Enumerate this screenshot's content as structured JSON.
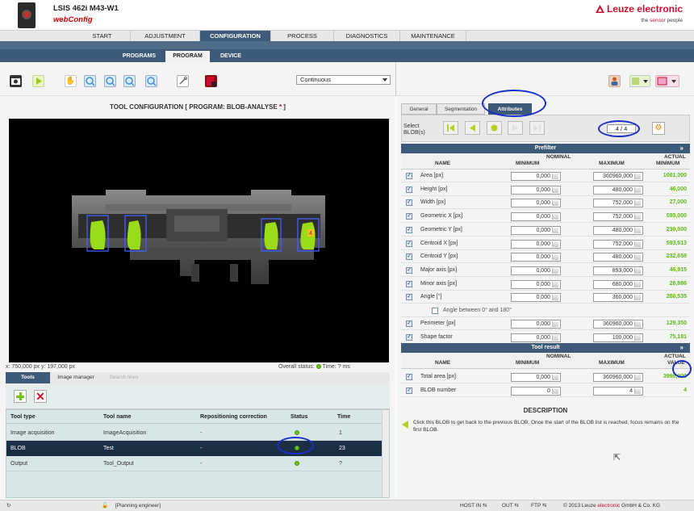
{
  "header": {
    "model": "LSIS 462i M43-W1",
    "app": "webConfig",
    "logo": "Leuze electronic",
    "tagline_pre": "the ",
    "tagline_brand": "sensor",
    "tagline_post": " people"
  },
  "main_nav": [
    "START",
    "ADJUSTMENT",
    "CONFIGURATION",
    "PROCESS",
    "DIAGNOSTICS",
    "MAINTENANCE"
  ],
  "main_nav_active": "CONFIGURATION",
  "sub_nav": [
    "PROGRAMS",
    "PROGRAM",
    "DEVICE"
  ],
  "sub_nav_active": "PROGRAM",
  "toolbar": {
    "mode_select": "Continuous",
    "icons": [
      "camera-icon",
      "play-icon",
      "hand-icon",
      "zoom-in-icon",
      "zoom-out-icon",
      "zoom-fit-icon",
      "zoom-reset-icon",
      "tools-icon",
      "save-icon",
      "user-icon",
      "layout-icon",
      "window-icon"
    ]
  },
  "tool_config": {
    "title_pre": "TOOL CONFIGURATION  [ PROGRAM: BLOB-ANALYSE ",
    "title_star": "*",
    "title_post": " ]"
  },
  "image": {
    "coords": "x: 750,000 px y: 197,000 px",
    "overall_status_label": "Overall status:",
    "time_label": "Time: ? ms",
    "blob_label": "4"
  },
  "left_tabs": [
    "Tools",
    "Image manager",
    "Search lines"
  ],
  "tools_table": {
    "headers": [
      "Tool type",
      "Tool name",
      "Repositioning correction",
      "Status",
      "Time"
    ],
    "rows": [
      {
        "type": "Image acquisition",
        "name": "ImageAcquisition",
        "repos": "-",
        "time": "1"
      },
      {
        "type": "BLOB",
        "name": "Test",
        "repos": "-",
        "time": "23"
      },
      {
        "type": "Output",
        "name": "Tool_Output",
        "repos": "-",
        "time": "?"
      }
    ]
  },
  "right_tabs": [
    "General",
    "Segmentation",
    "Attributes"
  ],
  "right_tabs_active": "Attributes",
  "blob_selector": {
    "label_line1": "Select",
    "label_line2": "BLOB(s)",
    "counter": "4 / 4"
  },
  "prefilter": {
    "title": "Prefilter",
    "col_name": "NAME",
    "col_nominal": "NOMINAL",
    "col_min": "MINIMUM",
    "col_max": "MAXIMUM",
    "col_actual1": "ACTUAL",
    "col_actual2": "MINIMUM",
    "rows": [
      {
        "name": "Area [px]",
        "min": "0,000",
        "max": "360960,000",
        "actual": "1001,000",
        "checked": true
      },
      {
        "name": "Height [px]",
        "min": "0,000",
        "max": "480,000",
        "actual": "46,000",
        "checked": true
      },
      {
        "name": "Width [px]",
        "min": "0,000",
        "max": "752,000",
        "actual": "27,000",
        "checked": true
      },
      {
        "name": "Geometric X [px]",
        "min": "0,000",
        "max": "752,000",
        "actual": "595,000",
        "checked": true
      },
      {
        "name": "Geometric Y [px]",
        "min": "0,000",
        "max": "480,000",
        "actual": "230,500",
        "checked": true
      },
      {
        "name": "Centroid X [px]",
        "min": "0,000",
        "max": "752,000",
        "actual": "593,613",
        "checked": true
      },
      {
        "name": "Centroid Y [px]",
        "min": "0,000",
        "max": "480,000",
        "actual": "232,658",
        "checked": true
      },
      {
        "name": "Major axis [px]",
        "min": "0,000",
        "max": "893,000",
        "actual": "46,915",
        "checked": true
      },
      {
        "name": "Minor axis [px]",
        "min": "0,000",
        "max": "680,000",
        "actual": "26,886",
        "checked": true
      },
      {
        "name": "Angle [°]",
        "min": "0,000",
        "max": "360,000",
        "actual": "280,535",
        "checked": true
      }
    ],
    "angle_option": "Angle between 0° and 180°",
    "rows2": [
      {
        "name": "Perimeter [px]",
        "min": "0,000",
        "max": "360960,000",
        "actual": "129,350",
        "checked": true
      },
      {
        "name": "Shape factor",
        "min": "0,000",
        "max": "100,000",
        "actual": "75,181",
        "checked": true
      }
    ]
  },
  "tool_result": {
    "title": "Tool result",
    "col_name": "NAME",
    "col_nominal": "NOMINAL",
    "col_min": "MINIMUM",
    "col_max": "MAXIMUM",
    "col_actual1": "ACTUAL",
    "col_actual2": "VALUE",
    "rows": [
      {
        "name": "Total area [px]",
        "min": "0,000",
        "max": "360960,000",
        "actual": "3998,000",
        "checked": true
      },
      {
        "name": "BLOB number",
        "min": "0",
        "max": "4",
        "actual": "4",
        "checked": true
      }
    ]
  },
  "description": {
    "title": "DESCRIPTION",
    "text": "Click this BLOB to get back to the previous BLOB. Once the start of the BLOB list is reached, focus remains on the first BLOB."
  },
  "statusbar": {
    "role": "[Planning engineer]",
    "host_in": "HOST IN",
    "out": "OUT",
    "ftp": "FTP",
    "copyright_pre": "© 2013 Leuze ",
    "copyright_brand": "electronic",
    "copyright_post": " GmbH & Co. KG"
  },
  "colors": {
    "nav_blue": "#3d5a78",
    "brand_red": "#c8102e",
    "ok_green": "#6ec21b",
    "highlight_blue": "#1a2ec8"
  }
}
